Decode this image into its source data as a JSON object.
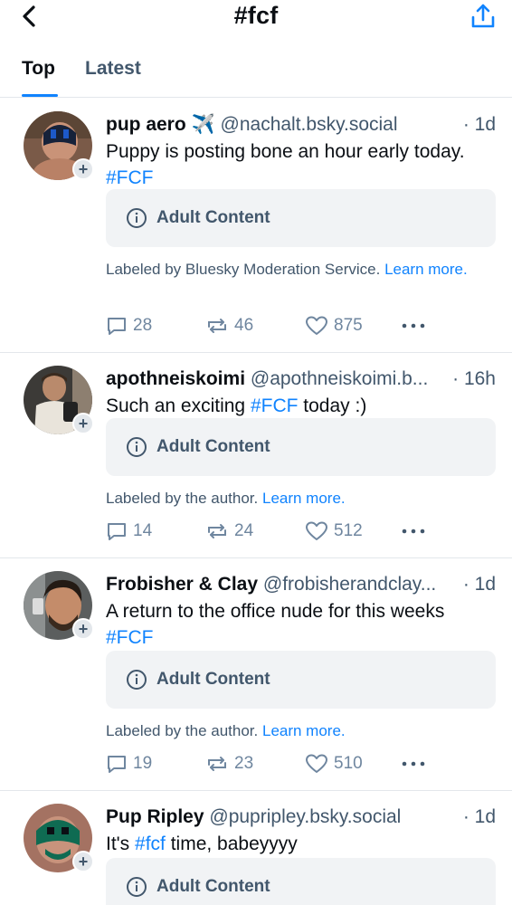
{
  "header": {
    "title": "#fcf",
    "back_icon": "chevron-left-icon",
    "share_icon": "share-upload-icon"
  },
  "tabs": [
    {
      "label": "Top",
      "selected": true
    },
    {
      "label": "Latest",
      "selected": false
    }
  ],
  "colors": {
    "accent": "#1083fe",
    "muted": "#42576c",
    "box": "#f1f3f5"
  },
  "posts": [
    {
      "author": "pup aero ✈️",
      "handle": "@nachalt.bsky.social",
      "time": "· 1d",
      "text_before": "Puppy is posting bone an hour early today. ",
      "hashtag": "#FCF",
      "text_after": "",
      "content_label": "Adult Content",
      "label_text": "Labeled by Bluesky Moderation Service. ",
      "learn_more": "Learn more.",
      "replies": "28",
      "reposts": "46",
      "likes": "875"
    },
    {
      "author": "apothneiskoimi",
      "handle": "@apothneiskoimi.b...",
      "time": "· 16h",
      "text_before": "Such an exciting ",
      "hashtag": "#FCF",
      "text_after": " today :)",
      "content_label": "Adult Content",
      "label_text": "Labeled by the author. ",
      "learn_more": "Learn more.",
      "replies": "14",
      "reposts": "24",
      "likes": "512"
    },
    {
      "author": "Frobisher & Clay",
      "handle": "@frobisherandclay...",
      "time": "· 1d",
      "text_before": "A return to the office nude for this weeks ",
      "hashtag": "#FCF",
      "text_after": "",
      "content_label": "Adult Content",
      "label_text": "Labeled by the author. ",
      "learn_more": "Learn more.",
      "replies": "19",
      "reposts": "23",
      "likes": "510"
    },
    {
      "author": "Pup Ripley",
      "handle": "@pupripley.bsky.social",
      "time": "· 1d",
      "text_before": "It's ",
      "hashtag": "#fcf",
      "text_after": " time, babeyyyy",
      "content_label": "Adult Content"
    }
  ]
}
